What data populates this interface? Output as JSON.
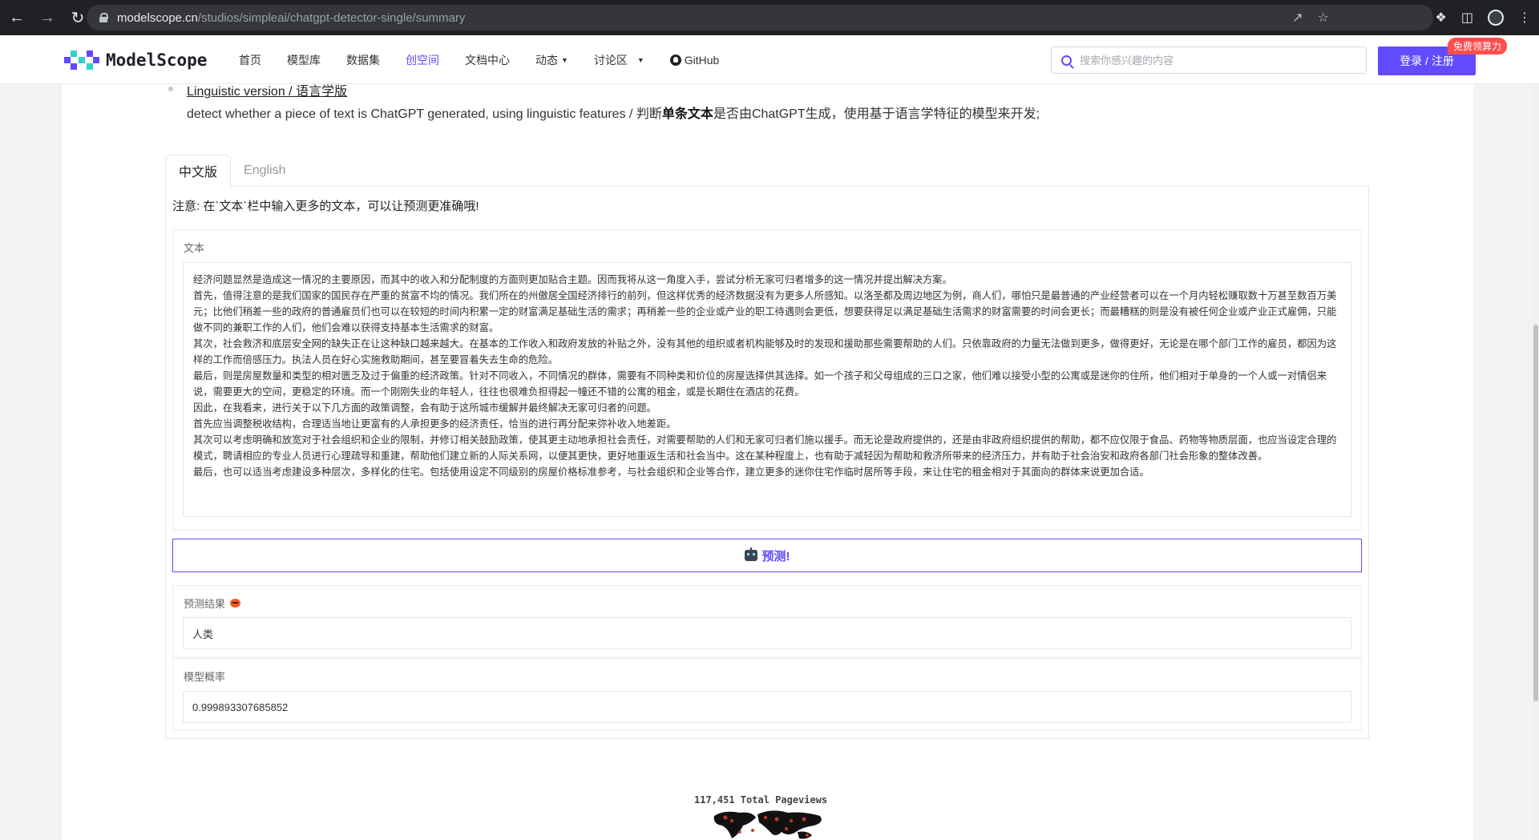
{
  "browser": {
    "url_host": "modelscope.cn",
    "url_path": "/studios/simpleai/chatgpt-detector-single/summary"
  },
  "header": {
    "logo_text": "ModelScope",
    "nav": [
      {
        "label": "首页"
      },
      {
        "label": "模型库"
      },
      {
        "label": "数据集"
      },
      {
        "label": "创空间"
      },
      {
        "label": "文档中心"
      },
      {
        "label": "动态"
      },
      {
        "label": "讨论区"
      },
      {
        "label": "GitHub"
      }
    ],
    "search_placeholder": "搜索你感兴趣的内容",
    "login_label": "登录 / 注册",
    "badge": "免费领算力"
  },
  "intro": {
    "link": "Linguistic version / 语言学版",
    "desc_before": "detect whether a piece of text is ChatGPT generated, using linguistic features / 判断",
    "desc_bold": "单条文本",
    "desc_after": "是否由ChatGPT生成，使用基于语言学特征的模型来开发;"
  },
  "tabs": [
    {
      "label": "中文版",
      "active": true
    },
    {
      "label": "English",
      "active": false
    }
  ],
  "note": "注意: 在`文本`栏中输入更多的文本，可以让预测更准确哦!",
  "text_block": {
    "label": "文本",
    "paragraphs": [
      "经济问题显然是造成这一情况的主要原因，而其中的收入和分配制度的方面则更加贴合主题。因而我将从这一角度入手，尝试分析无家可归者增多的这一情况并提出解决方案。",
      "首先，值得注意的是我们国家的国民存在严重的贫富不均的情况。我们所在的州傲居全国经济排行的前列，但这样优秀的经济数据没有为更多人所感知。以洛圣都及周边地区为例，商人们，哪怕只是最普通的产业经营者可以在一个月内轻松赚取数十万甚至数百万美元；比他们稍差一些的政府的普通雇员们也可以在较短的时间内积累一定的财富满足基础生活的需求；再稍差一些的企业或产业的职工待遇则会更低，想要获得足以满足基础生活需求的财富需要的时间会更长；而最糟糕的则是没有被任何企业或产业正式雇佣，只能做不同的兼职工作的人们，他们会难以获得支持基本生活需求的财富。",
      "其次，社会救济和底层安全网的缺失正在让这种缺口越来越大。在基本的工作收入和政府发放的补贴之外，没有其他的组织或者机构能够及时的发现和援助那些需要帮助的人们。只依靠政府的力量无法做到更多，做得更好，无论是在哪个部门工作的雇员，都因为这样的工作而倍感压力。执法人员在好心实施救助期间，甚至要冒着失去生命的危险。",
      "最后，则是房屋数量和类型的相对匮乏及过于偏重的经济政策。针对不同收入，不同情况的群体，需要有不同种类和价位的房屋选择供其选择。如一个孩子和父母组成的三口之家，他们难以接受小型的公寓或是迷你的住所，他们相对于单身的一个人或一对情侣来说，需要更大的空间，更稳定的环境。而一个刚刚失业的年轻人，往往也很难负担得起一幢还不错的公寓的租金，或是长期住在酒店的花费。",
      "因此，在我看来，进行关于以下几方面的政策调整，会有助于这所城市缓解并最终解决无家可归者的问题。",
      "首先应当调整税收结构，合理适当地让更富有的人承担更多的经济责任，恰当的进行再分配来弥补收入地差距。",
      "其次可以考虑明确和放宽对于社会组织和企业的限制，并修订相关鼓励政策，使其更主动地承担社会责任，对需要帮助的人们和无家可归者们施以援手。而无论是政府提供的，还是由非政府组织提供的帮助，都不应仅限于食品、药物等物质层面，也应当设定合理的模式，聘请相应的专业人员进行心理疏导和重建，帮助他们建立新的人际关系网，以便其更快，更好地重返生活和社会当中。这在某种程度上，也有助于减轻因为帮助和救济所带来的经济压力，并有助于社会治安和政府各部门社会形象的整体改善。",
      "最后，也可以适当考虑建设多种层次，多样化的住宅。包括使用设定不同级别的房屋价格标准参考，与社会组织和企业等合作，建立更多的迷你住宅作临时居所等手段，来让住宅的租金相对于其面向的群体来说更加合适。"
    ]
  },
  "predict_button": "预测!",
  "result": {
    "label": "预测结果",
    "value": "人类"
  },
  "probability": {
    "label": "模型概率",
    "value": "0.999893307685852"
  },
  "footer": {
    "pageviews": "117,451 Total Pageviews"
  },
  "colors": {
    "brand": "#624aff",
    "badge": "#ff4d4f",
    "chrome": "#202124"
  }
}
